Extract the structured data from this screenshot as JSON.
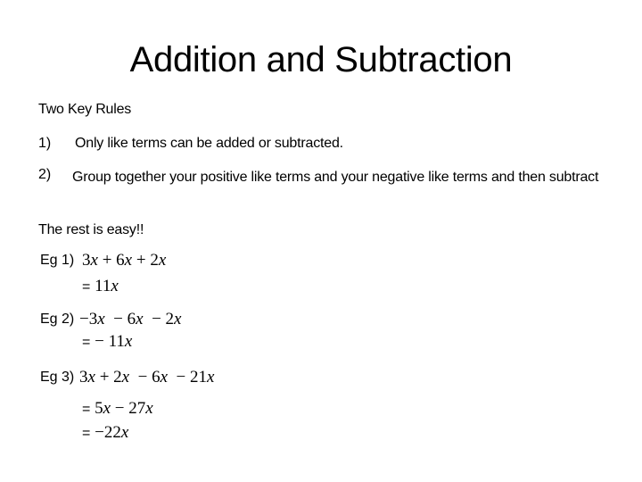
{
  "slide": {
    "title": "Addition and Subtraction",
    "subtitle": "Two Key Rules",
    "rules": [
      {
        "number": "1)",
        "text": "Only like terms can be added or subtracted."
      },
      {
        "number": "2)",
        "text": "Group together your positive like terms and your negative like terms and then subtract"
      }
    ],
    "closing": "The rest is easy!!",
    "examples": [
      {
        "label": "Eg 1)",
        "expression": "3x + 6x + 2x",
        "steps": [
          "= 11x"
        ]
      },
      {
        "label": "Eg 2)",
        "expression": "−3x  − 6x  − 2x",
        "steps": [
          "= − 11x"
        ]
      },
      {
        "label": "Eg 3)",
        "expression": "3x + 2x  − 6x  − 21x",
        "steps": [
          "= 5x − 27x",
          "= −22x"
        ]
      }
    ]
  }
}
